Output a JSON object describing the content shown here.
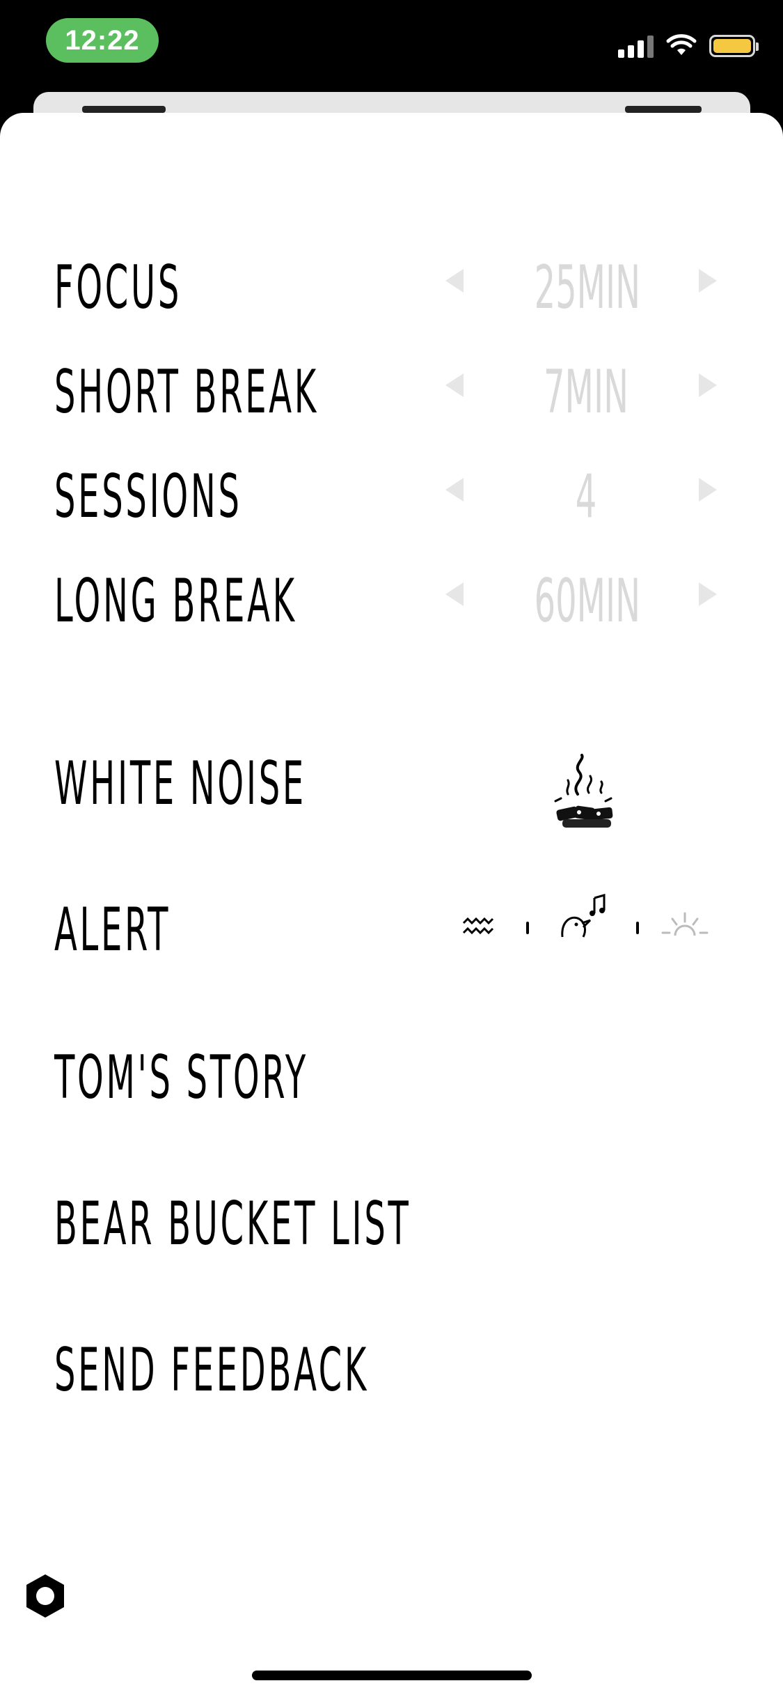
{
  "status_bar": {
    "time": "12:22",
    "icons": [
      "cellular-signal-icon",
      "wifi-icon",
      "battery-icon"
    ],
    "colors": {
      "time_pill": "#5cbf5f",
      "battery_fill": "#f5c842"
    },
    "battery_level": 0.9
  },
  "timer_settings": [
    {
      "label": "FOCUS",
      "value": "25MIN"
    },
    {
      "label": "SHORT BREAK",
      "value": "7MIN"
    },
    {
      "label": "SESSIONS",
      "value": "4"
    },
    {
      "label": "LONG BREAK",
      "value": "60MIN"
    }
  ],
  "white_noise": {
    "label": "WHITE NOISE",
    "icon": "campfire-icon"
  },
  "alert": {
    "label": "ALERT",
    "options": [
      "wave-sound-icon",
      "bird-sound-icon",
      "sunrise-sound-icon"
    ]
  },
  "menu": {
    "toms_story": "TOM'S STORY",
    "bucket_list": "BEAR BUCKET LIST",
    "feedback": "SEND FEEDBACK"
  },
  "footer": {
    "icon": "hexagon-settings-icon"
  }
}
